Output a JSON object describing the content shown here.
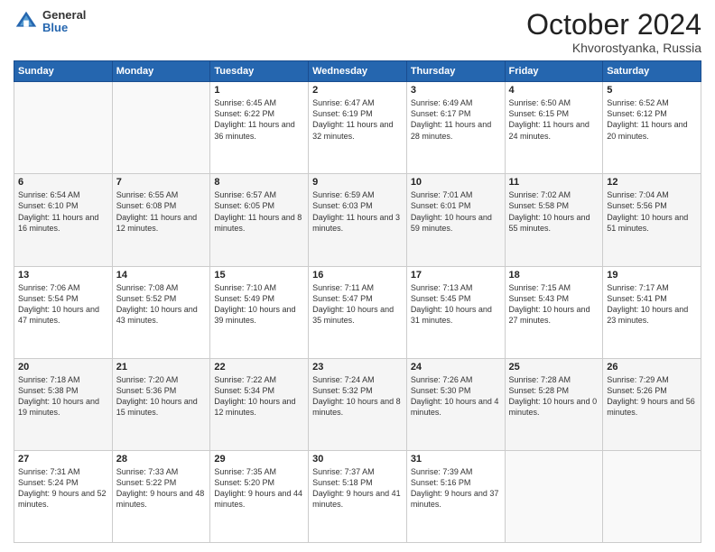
{
  "header": {
    "logo_general": "General",
    "logo_blue": "Blue",
    "title": "October 2024",
    "location": "Khvorostyanka, Russia"
  },
  "weekdays": [
    "Sunday",
    "Monday",
    "Tuesday",
    "Wednesday",
    "Thursday",
    "Friday",
    "Saturday"
  ],
  "weeks": [
    [
      {
        "day": "",
        "info": ""
      },
      {
        "day": "",
        "info": ""
      },
      {
        "day": "1",
        "info": "Sunrise: 6:45 AM\nSunset: 6:22 PM\nDaylight: 11 hours and 36 minutes."
      },
      {
        "day": "2",
        "info": "Sunrise: 6:47 AM\nSunset: 6:19 PM\nDaylight: 11 hours and 32 minutes."
      },
      {
        "day": "3",
        "info": "Sunrise: 6:49 AM\nSunset: 6:17 PM\nDaylight: 11 hours and 28 minutes."
      },
      {
        "day": "4",
        "info": "Sunrise: 6:50 AM\nSunset: 6:15 PM\nDaylight: 11 hours and 24 minutes."
      },
      {
        "day": "5",
        "info": "Sunrise: 6:52 AM\nSunset: 6:12 PM\nDaylight: 11 hours and 20 minutes."
      }
    ],
    [
      {
        "day": "6",
        "info": "Sunrise: 6:54 AM\nSunset: 6:10 PM\nDaylight: 11 hours and 16 minutes."
      },
      {
        "day": "7",
        "info": "Sunrise: 6:55 AM\nSunset: 6:08 PM\nDaylight: 11 hours and 12 minutes."
      },
      {
        "day": "8",
        "info": "Sunrise: 6:57 AM\nSunset: 6:05 PM\nDaylight: 11 hours and 8 minutes."
      },
      {
        "day": "9",
        "info": "Sunrise: 6:59 AM\nSunset: 6:03 PM\nDaylight: 11 hours and 3 minutes."
      },
      {
        "day": "10",
        "info": "Sunrise: 7:01 AM\nSunset: 6:01 PM\nDaylight: 10 hours and 59 minutes."
      },
      {
        "day": "11",
        "info": "Sunrise: 7:02 AM\nSunset: 5:58 PM\nDaylight: 10 hours and 55 minutes."
      },
      {
        "day": "12",
        "info": "Sunrise: 7:04 AM\nSunset: 5:56 PM\nDaylight: 10 hours and 51 minutes."
      }
    ],
    [
      {
        "day": "13",
        "info": "Sunrise: 7:06 AM\nSunset: 5:54 PM\nDaylight: 10 hours and 47 minutes."
      },
      {
        "day": "14",
        "info": "Sunrise: 7:08 AM\nSunset: 5:52 PM\nDaylight: 10 hours and 43 minutes."
      },
      {
        "day": "15",
        "info": "Sunrise: 7:10 AM\nSunset: 5:49 PM\nDaylight: 10 hours and 39 minutes."
      },
      {
        "day": "16",
        "info": "Sunrise: 7:11 AM\nSunset: 5:47 PM\nDaylight: 10 hours and 35 minutes."
      },
      {
        "day": "17",
        "info": "Sunrise: 7:13 AM\nSunset: 5:45 PM\nDaylight: 10 hours and 31 minutes."
      },
      {
        "day": "18",
        "info": "Sunrise: 7:15 AM\nSunset: 5:43 PM\nDaylight: 10 hours and 27 minutes."
      },
      {
        "day": "19",
        "info": "Sunrise: 7:17 AM\nSunset: 5:41 PM\nDaylight: 10 hours and 23 minutes."
      }
    ],
    [
      {
        "day": "20",
        "info": "Sunrise: 7:18 AM\nSunset: 5:38 PM\nDaylight: 10 hours and 19 minutes."
      },
      {
        "day": "21",
        "info": "Sunrise: 7:20 AM\nSunset: 5:36 PM\nDaylight: 10 hours and 15 minutes."
      },
      {
        "day": "22",
        "info": "Sunrise: 7:22 AM\nSunset: 5:34 PM\nDaylight: 10 hours and 12 minutes."
      },
      {
        "day": "23",
        "info": "Sunrise: 7:24 AM\nSunset: 5:32 PM\nDaylight: 10 hours and 8 minutes."
      },
      {
        "day": "24",
        "info": "Sunrise: 7:26 AM\nSunset: 5:30 PM\nDaylight: 10 hours and 4 minutes."
      },
      {
        "day": "25",
        "info": "Sunrise: 7:28 AM\nSunset: 5:28 PM\nDaylight: 10 hours and 0 minutes."
      },
      {
        "day": "26",
        "info": "Sunrise: 7:29 AM\nSunset: 5:26 PM\nDaylight: 9 hours and 56 minutes."
      }
    ],
    [
      {
        "day": "27",
        "info": "Sunrise: 7:31 AM\nSunset: 5:24 PM\nDaylight: 9 hours and 52 minutes."
      },
      {
        "day": "28",
        "info": "Sunrise: 7:33 AM\nSunset: 5:22 PM\nDaylight: 9 hours and 48 minutes."
      },
      {
        "day": "29",
        "info": "Sunrise: 7:35 AM\nSunset: 5:20 PM\nDaylight: 9 hours and 44 minutes."
      },
      {
        "day": "30",
        "info": "Sunrise: 7:37 AM\nSunset: 5:18 PM\nDaylight: 9 hours and 41 minutes."
      },
      {
        "day": "31",
        "info": "Sunrise: 7:39 AM\nSunset: 5:16 PM\nDaylight: 9 hours and 37 minutes."
      },
      {
        "day": "",
        "info": ""
      },
      {
        "day": "",
        "info": ""
      }
    ]
  ]
}
